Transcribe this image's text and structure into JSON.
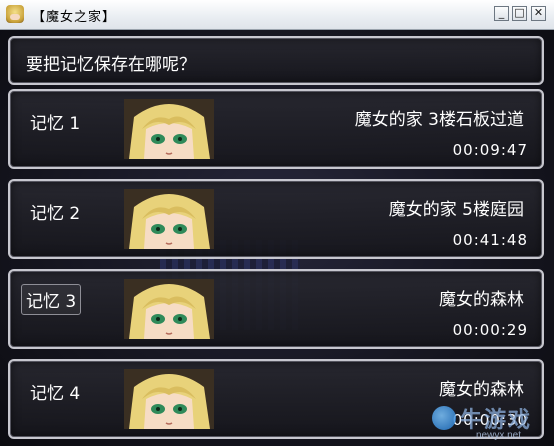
{
  "window": {
    "title": "【魔女之家】",
    "min_label": "_",
    "max_label": "□",
    "close_label": "✕"
  },
  "header": {
    "prompt": "要把记忆保存在哪呢？"
  },
  "slots": [
    {
      "label": "记忆  1",
      "location": "魔女的家  3楼石板过道",
      "time": "00:09:47",
      "selected": false,
      "portrait_icon": "viola-portrait"
    },
    {
      "label": "记忆  2",
      "location": "魔女的家  5楼庭园",
      "time": "00:41:48",
      "selected": false,
      "portrait_icon": "viola-portrait"
    },
    {
      "label": "记忆  3",
      "location": "魔女的森林",
      "time": "00:00:29",
      "selected": true,
      "portrait_icon": "viola-portrait"
    },
    {
      "label": "记忆  4",
      "location": "魔女的森林",
      "time": "00:00:30",
      "selected": false,
      "portrait_icon": "viola-portrait"
    }
  ],
  "watermark": {
    "text": "牛游戏",
    "url": "newyx.net"
  },
  "colors": {
    "panel_border": "#c7c7cf",
    "panel_bg": "#1e1e26",
    "text": "#ffffff",
    "hair": "#e8d27a",
    "eyes": "#2f8a5a"
  }
}
